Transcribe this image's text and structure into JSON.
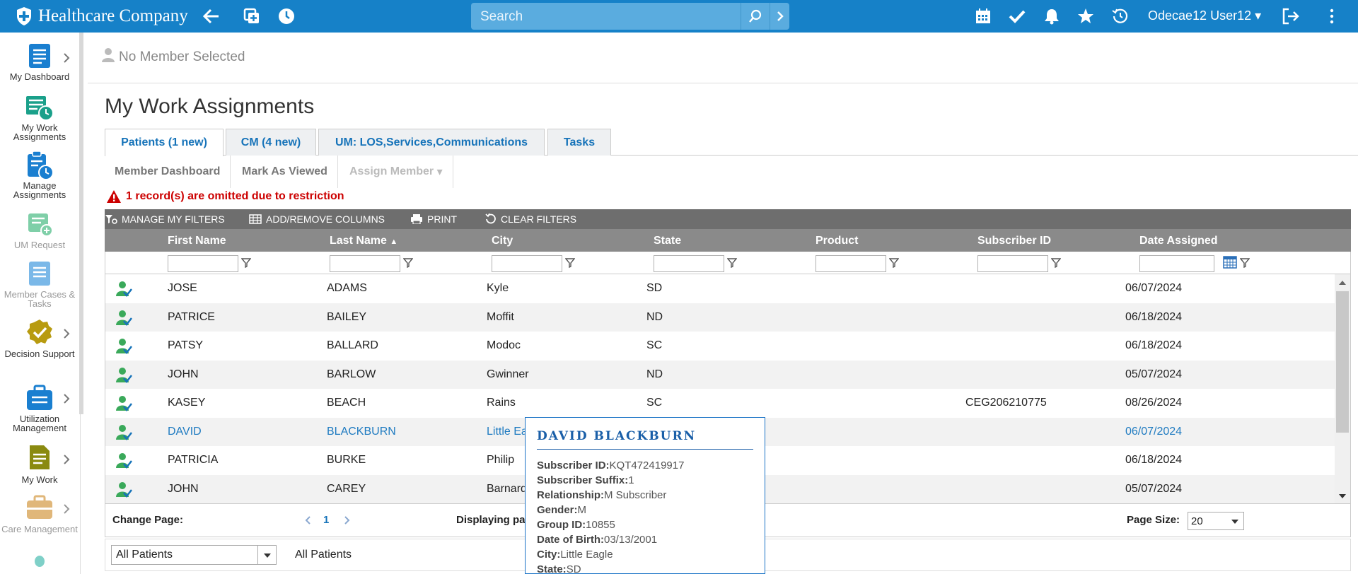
{
  "app": {
    "brand": "Healthcare Company",
    "search_placeholder": "Search",
    "user": "Odecae12 User12"
  },
  "sidebar": {
    "items": [
      {
        "label": "My Dashboard"
      },
      {
        "label": "My Work Assignments"
      },
      {
        "label": "Manage Assignments"
      },
      {
        "label": "UM Request"
      },
      {
        "label": "Member Cases & Tasks"
      },
      {
        "label": "Decision Support"
      },
      {
        "label": "Utilization Management"
      },
      {
        "label": "My Work"
      },
      {
        "label": "Care Management"
      }
    ]
  },
  "member": {
    "label": "No Member Selected"
  },
  "page": {
    "title": "My Work Assignments"
  },
  "tabs": [
    {
      "label": "Patients (1 new)"
    },
    {
      "label": "CM (4 new)"
    },
    {
      "label": "UM: LOS,Services,Communications"
    },
    {
      "label": "Tasks"
    }
  ],
  "actions": [
    {
      "label": "Member Dashboard"
    },
    {
      "label": "Mark As Viewed"
    },
    {
      "label": "Assign Member"
    }
  ],
  "warning": "1 record(s) are omitted due to restriction",
  "toolbar": {
    "manage_filters": "MANAGE MY FILTERS",
    "add_columns": "ADD/REMOVE COLUMNS",
    "print": "PRINT",
    "clear_filters": "CLEAR FILTERS"
  },
  "columns": [
    "First Name",
    "Last Name",
    "City",
    "State",
    "Product",
    "Subscriber ID",
    "Date Assigned"
  ],
  "rows": [
    {
      "first": "JOSE",
      "last": "ADAMS",
      "city": "Kyle",
      "state": "SD",
      "product": "",
      "subscriber": "",
      "date": "06/07/2024"
    },
    {
      "first": "PATRICE",
      "last": "BAILEY",
      "city": "Moffit",
      "state": "ND",
      "product": "",
      "subscriber": "",
      "date": "06/18/2024"
    },
    {
      "first": "PATSY",
      "last": "BALLARD",
      "city": "Modoc",
      "state": "SC",
      "product": "",
      "subscriber": "",
      "date": "06/18/2024"
    },
    {
      "first": "JOHN",
      "last": "BARLOW",
      "city": "Gwinner",
      "state": "ND",
      "product": "",
      "subscriber": "",
      "date": "05/07/2024"
    },
    {
      "first": "KASEY",
      "last": "BEACH",
      "city": "Rains",
      "state": "SC",
      "product": "",
      "subscriber": "CEG206210775",
      "date": "08/26/2024"
    },
    {
      "first": "DAVID",
      "last": "BLACKBURN",
      "city": "Little Ea",
      "state": "",
      "product": "",
      "subscriber": "",
      "date": "06/07/2024"
    },
    {
      "first": "PATRICIA",
      "last": "BURKE",
      "city": "Philip",
      "state": "",
      "product": "",
      "subscriber": "",
      "date": "06/18/2024"
    },
    {
      "first": "JOHN",
      "last": "CAREY",
      "city": "Barnard",
      "state": "",
      "product": "",
      "subscriber": "",
      "date": "05/07/2024"
    }
  ],
  "pager": {
    "change_page": "Change Page:",
    "page": "1",
    "displaying": "Displaying pa",
    "page_size_label": "Page Size:",
    "page_size": "20"
  },
  "bottom": {
    "select_value": "All Patients",
    "label": "All Patients"
  },
  "popup": {
    "title": "DAVID BLACKBURN",
    "fields": [
      {
        "k": "Subscriber ID:",
        "v": "KQT472419917"
      },
      {
        "k": "Subscriber Suffix:",
        "v": "1"
      },
      {
        "k": "Relationship:",
        "v": "M Subscriber"
      },
      {
        "k": "Gender:",
        "v": "M"
      },
      {
        "k": "Group ID:",
        "v": "10855"
      },
      {
        "k": "Date of Birth:",
        "v": "03/13/2001"
      },
      {
        "k": "City:",
        "v": "Little Eagle"
      },
      {
        "k": "State:",
        "v": "SD"
      }
    ]
  },
  "colors": {
    "brand": "#1681c8",
    "link": "#1673b9",
    "warning": "#cc0000"
  }
}
